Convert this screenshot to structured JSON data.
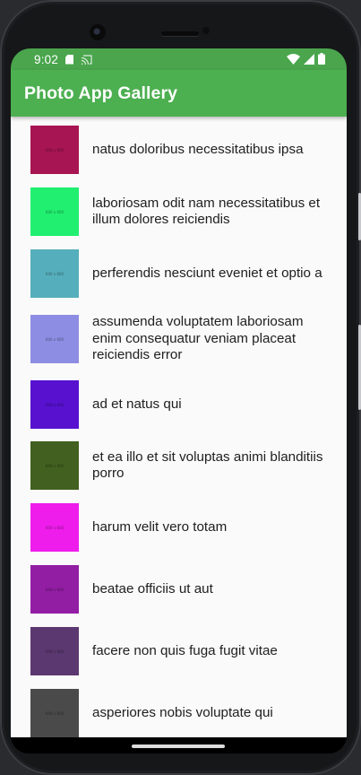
{
  "status_bar": {
    "time": "9:02",
    "sd_card_icon": "sd-card-icon",
    "cast_icon": "cast-icon",
    "wifi_icon": "wifi-icon",
    "signal_icon": "signal-icon",
    "battery_icon": "battery-icon"
  },
  "app_bar": {
    "title": "Photo App Gallery",
    "color": "#4caf50"
  },
  "photos": [
    {
      "title": "natus doloribus necessitatibus ipsa",
      "thumb_label": "600 x 600",
      "thumb_color": "#a71552"
    },
    {
      "title": "laboriosam odit nam necessitatibus et illum dolores reiciendis",
      "thumb_label": "600 x 600",
      "thumb_color": "#21ef6f"
    },
    {
      "title": "perferendis nesciunt eveniet et optio a",
      "thumb_label": "600 x 600",
      "thumb_color": "#55aebb"
    },
    {
      "title": "assumenda voluptatem laboriosam enim consequatur veniam placeat reiciendis error",
      "thumb_label": "600 x 600",
      "thumb_color": "#8d8de3"
    },
    {
      "title": "ad et natus qui",
      "thumb_label": "600 x 600",
      "thumb_color": "#5711cf"
    },
    {
      "title": "et ea illo et sit voluptas animi blanditiis porro",
      "thumb_label": "600 x 600",
      "thumb_color": "#42601f"
    },
    {
      "title": "harum velit vero totam",
      "thumb_label": "600 x 600",
      "thumb_color": "#ee1deb"
    },
    {
      "title": "beatae officiis ut aut",
      "thumb_label": "600 x 600",
      "thumb_color": "#921ea3"
    },
    {
      "title": "facere non quis fuga fugit vitae",
      "thumb_label": "600 x 600",
      "thumb_color": "#5b386f"
    },
    {
      "title": "asperiores nobis voluptate qui",
      "thumb_label": "600 x 600",
      "thumb_color": "#4a4a4a"
    }
  ]
}
